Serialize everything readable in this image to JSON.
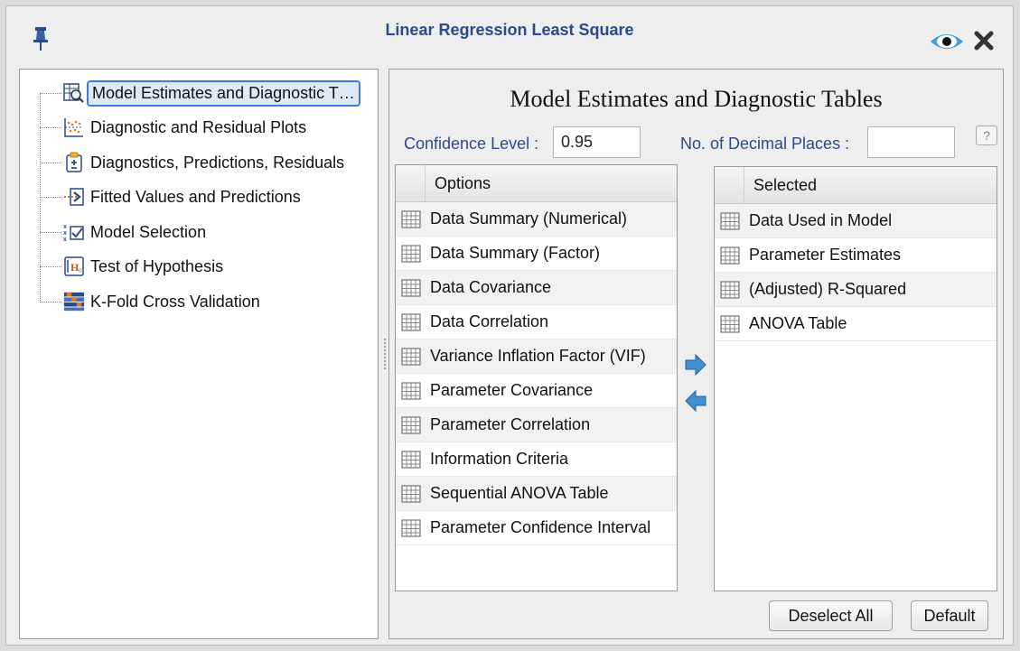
{
  "window": {
    "title": "Linear Regression Least Square"
  },
  "tree": {
    "items": [
      {
        "label": "Model Estimates and Diagnostic T…",
        "icon": "table-magnifier-icon",
        "selected": true
      },
      {
        "label": "Diagnostic and Residual Plots",
        "icon": "residual-plot-icon"
      },
      {
        "label": "Diagnostics, Predictions, Residuals",
        "icon": "clipboard-plusminus-icon"
      },
      {
        "label": "Fitted Values and Predictions",
        "icon": "arrow-into-box-icon"
      },
      {
        "label": "Model Selection",
        "icon": "checkbox-x-icon"
      },
      {
        "label": "Test of Hypothesis",
        "icon": "h0-icon"
      },
      {
        "label": "K-Fold Cross Validation",
        "icon": "kfold-grid-icon"
      }
    ]
  },
  "panel": {
    "title": "Model Estimates and Diagnostic Tables",
    "confidence_label": "Confidence Level :",
    "confidence_value": "0.95",
    "decimal_label": "No. of Decimal Places :",
    "decimal_value": "",
    "help_label": "?",
    "options_header": "Options",
    "selected_header": "Selected",
    "options": [
      "Data Summary (Numerical)",
      "Data Summary (Factor)",
      "Data Covariance",
      "Data Correlation",
      "Variance Inflation Factor (VIF)",
      "Parameter Covariance",
      "Parameter Correlation",
      "Information Criteria",
      "Sequential ANOVA Table",
      "Parameter Confidence Interval"
    ],
    "selected": [
      "Data Used in Model",
      "Parameter Estimates",
      "(Adjusted) R-Squared",
      "ANOVA Table"
    ],
    "deselect_all_label": "Deselect All",
    "default_label": "Default"
  },
  "colors": {
    "accent": "#2a4a8c",
    "arrow": "#3f8fd1"
  }
}
